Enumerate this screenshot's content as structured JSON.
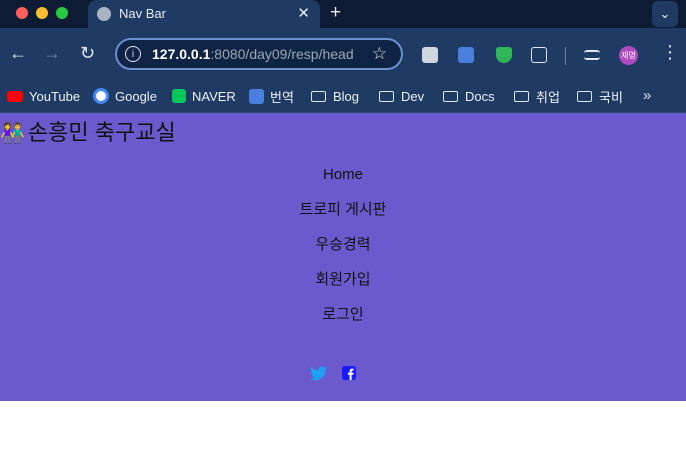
{
  "browser": {
    "tab_title": "Nav Bar",
    "url_host": "127.0.0.1",
    "url_rest": ":8080/day09/resp/head",
    "profile_initials": "재영"
  },
  "bookmarks": [
    {
      "label": "YouTube",
      "icon": "youtube-icon"
    },
    {
      "label": "Google",
      "icon": "google-icon"
    },
    {
      "label": "NAVER",
      "icon": "naver-icon"
    },
    {
      "label": "번역",
      "icon": "translate-icon"
    },
    {
      "label": "Blog",
      "icon": "folder-icon"
    },
    {
      "label": "Dev",
      "icon": "folder-icon"
    },
    {
      "label": "Docs",
      "icon": "folder-icon"
    },
    {
      "label": "취업",
      "icon": "folder-icon"
    },
    {
      "label": "국비",
      "icon": "folder-icon"
    }
  ],
  "page": {
    "brand": "손흥민 축구교실",
    "nav_items": [
      "Home",
      "트로피 게시판",
      "우승경력",
      "회원가입",
      "로그인"
    ],
    "social": [
      "twitter-icon",
      "facebook-icon"
    ],
    "colors": {
      "nav_bg": "#6a5acd",
      "twitter": "#1da1f2",
      "facebook": "#1a1aff"
    }
  }
}
